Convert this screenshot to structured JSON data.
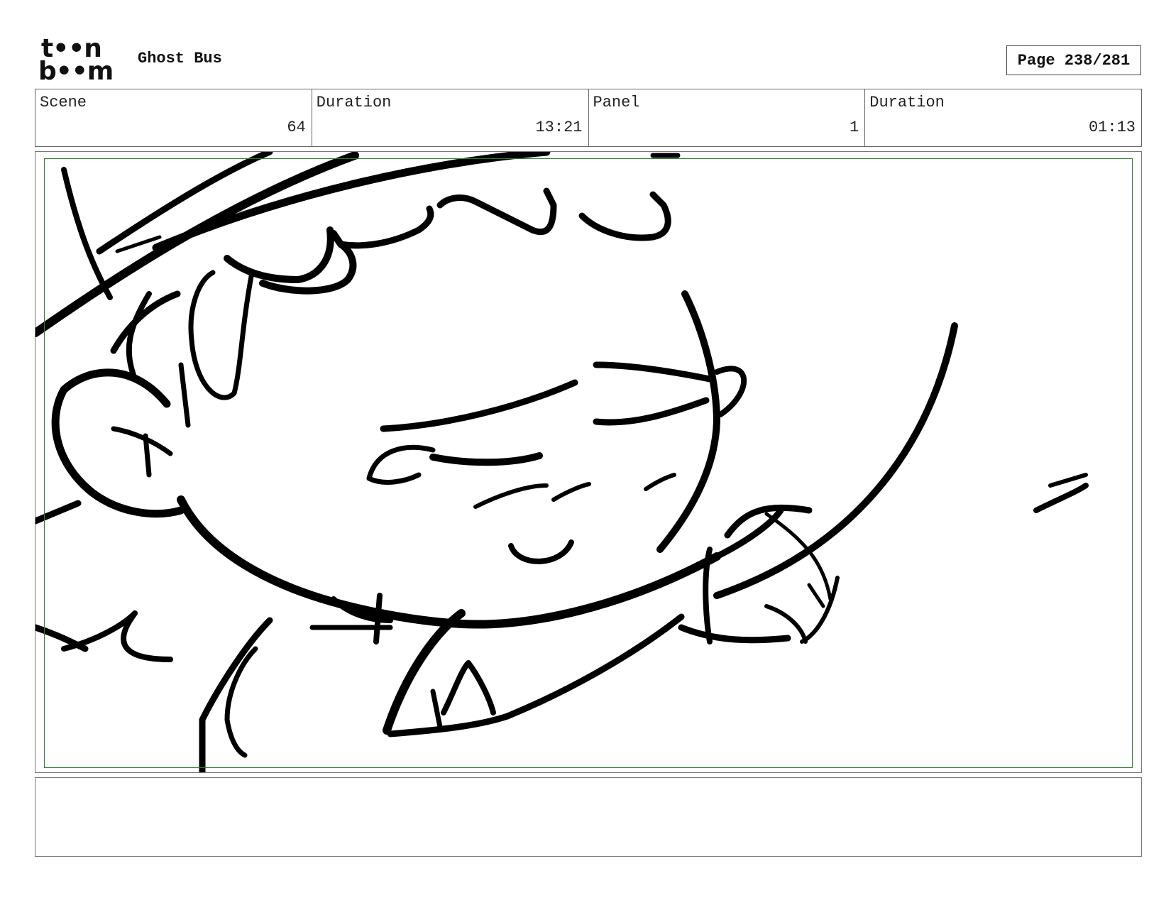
{
  "header": {
    "logo_line1": "t••n",
    "logo_line2": "b••m",
    "project_title": "Ghost Bus",
    "page_label": "Page 238/281"
  },
  "info": {
    "scene_label": "Scene",
    "scene_value": "64",
    "scene_duration_label": "Duration",
    "scene_duration_value": "13:21",
    "panel_label": "Panel",
    "panel_value": "1",
    "panel_duration_label": "Duration",
    "panel_duration_value": "01:13"
  },
  "colors": {
    "safe_area": "#2e7d32",
    "ink": "#000000"
  }
}
